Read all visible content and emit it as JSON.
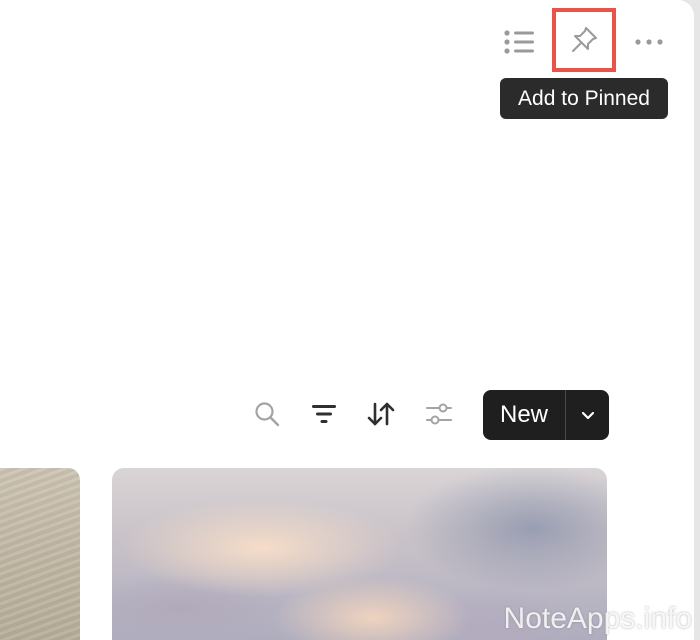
{
  "top_toolbar": {
    "list_icon": "list-icon",
    "pin_icon": "pin-icon",
    "more_icon": "more-horizontal-icon"
  },
  "tooltip": {
    "text": "Add to Pinned"
  },
  "view_toolbar": {
    "search_icon": "search-icon",
    "filter_icon": "filter-icon",
    "sort_icon": "sort-icon",
    "properties_icon": "sliders-icon",
    "new_label": "New",
    "dropdown_icon": "chevron-down-icon"
  },
  "gallery": {
    "cards": [
      {
        "cover": "sand"
      },
      {
        "cover": "sky"
      }
    ]
  },
  "watermark": "NoteApps.info",
  "colors": {
    "highlight": "#e8534a",
    "tooltip_bg": "#2b2b2b",
    "new_button_bg": "#1f1f1f"
  }
}
